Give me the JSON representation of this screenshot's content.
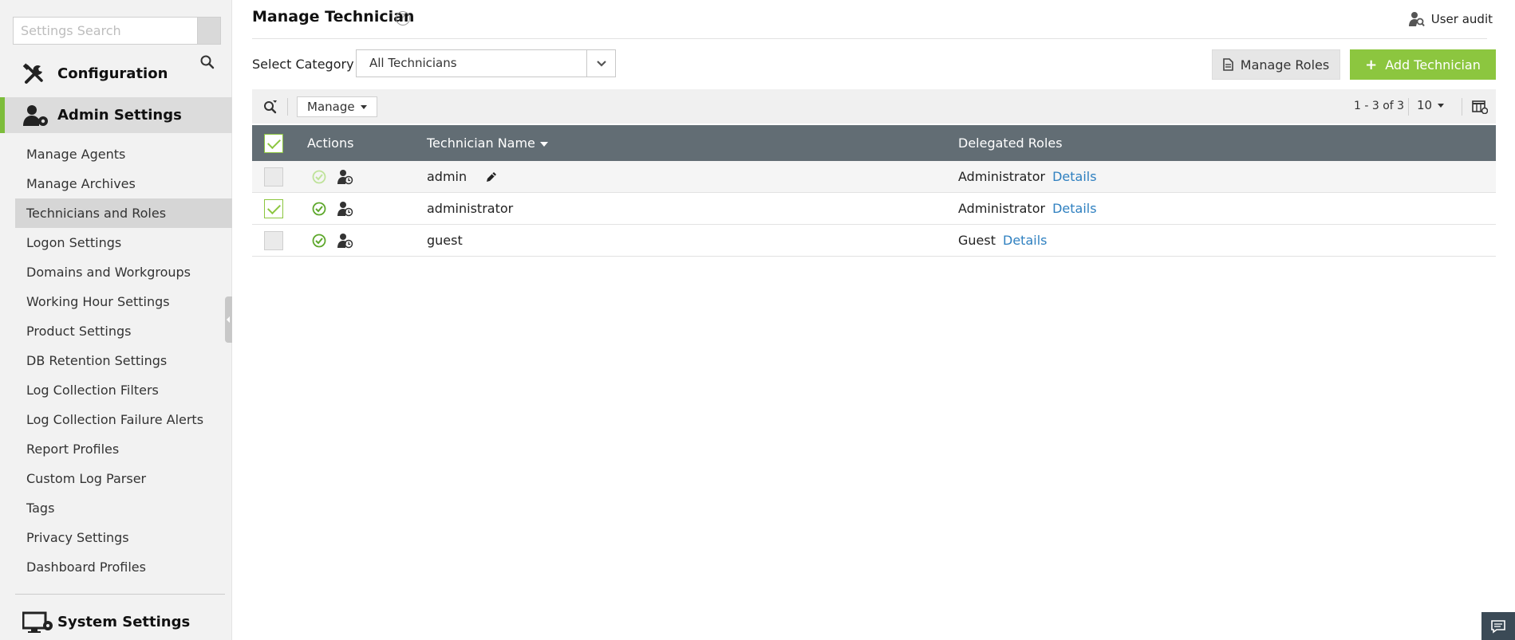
{
  "sidebar": {
    "search_placeholder": "Settings Search",
    "sections": {
      "configuration": "Configuration",
      "admin_settings": "Admin Settings",
      "system_settings": "System Settings"
    },
    "items": [
      {
        "label": "Manage Agents",
        "active": false
      },
      {
        "label": "Manage Archives",
        "active": false
      },
      {
        "label": "Technicians and Roles",
        "active": true
      },
      {
        "label": "Logon Settings",
        "active": false
      },
      {
        "label": "Domains and Workgroups",
        "active": false
      },
      {
        "label": "Working Hour Settings",
        "active": false
      },
      {
        "label": "Product Settings",
        "active": false
      },
      {
        "label": "DB Retention Settings",
        "active": false
      },
      {
        "label": "Log Collection Filters",
        "active": false
      },
      {
        "label": "Log Collection Failure Alerts",
        "active": false
      },
      {
        "label": "Report Profiles",
        "active": false
      },
      {
        "label": "Custom Log Parser",
        "active": false
      },
      {
        "label": "Tags",
        "active": false
      },
      {
        "label": "Privacy Settings",
        "active": false
      },
      {
        "label": "Dashboard Profiles",
        "active": false
      }
    ]
  },
  "header": {
    "title": "Manage Technician",
    "help_symbol": "?",
    "user_audit": "User audit"
  },
  "filters": {
    "category_label": "Select Category",
    "category_value": "All Technicians",
    "manage_roles": "Manage Roles",
    "add_technician": "Add Technician",
    "add_symbol": "+"
  },
  "toolbar": {
    "manage": "Manage",
    "range": "1 - 3 of 3",
    "per_page": "10"
  },
  "table": {
    "columns": {
      "actions": "Actions",
      "technician_name": "Technician Name",
      "delegated_roles": "Delegated Roles"
    },
    "details_label": "Details",
    "rows": [
      {
        "name": "admin",
        "role": "Administrator",
        "checked": false,
        "enabled_dimmed": true,
        "editable": true
      },
      {
        "name": "administrator",
        "role": "Administrator",
        "checked": true,
        "enabled_dimmed": false,
        "editable": false
      },
      {
        "name": "guest",
        "role": "Guest",
        "checked": false,
        "enabled_dimmed": false,
        "editable": false
      }
    ]
  },
  "colors": {
    "accent_green": "#8cc63f",
    "header_gray": "#626d74",
    "link_blue": "#2f80c0",
    "chat_bg": "#3b4a56"
  },
  "icons": {
    "sidebar_search": "search-icon",
    "configuration": "tools-icon",
    "admin_settings": "user-gear-icon",
    "system_settings": "monitor-gear-icon",
    "user_audit": "user-search-icon",
    "manage_roles": "document-icon",
    "toolbar_search": "search-filter-icon",
    "column_settings": "table-settings-icon",
    "status": "check-circle-icon",
    "user_activity": "user-clock-icon",
    "edit": "pencil-icon",
    "chat": "chat-icon"
  }
}
